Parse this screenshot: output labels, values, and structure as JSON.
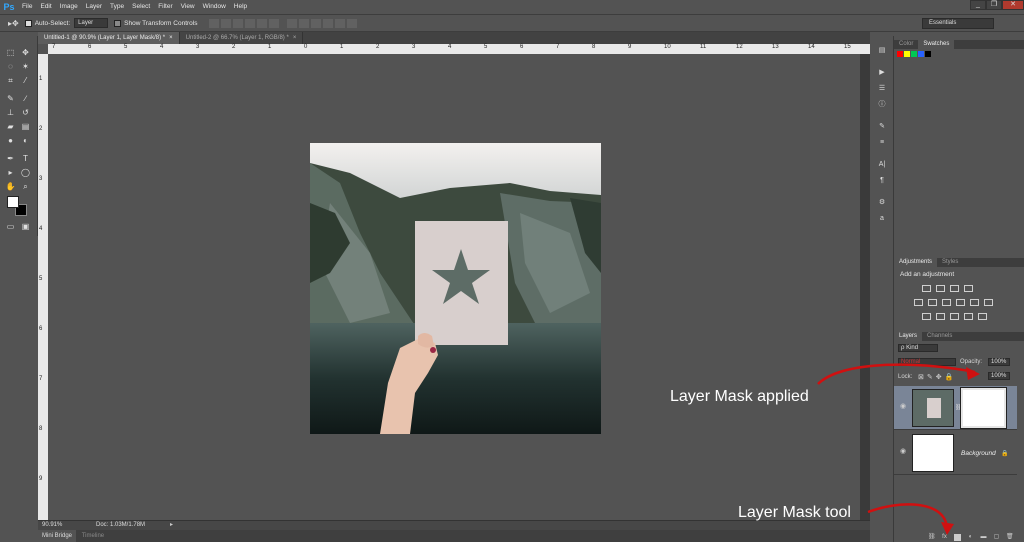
{
  "app": {
    "logo": "Ps"
  },
  "menu": [
    "File",
    "Edit",
    "Image",
    "Layer",
    "Type",
    "Select",
    "Filter",
    "View",
    "Window",
    "Help"
  ],
  "window_buttons": [
    "_",
    "❐",
    "✕"
  ],
  "options_bar": {
    "auto_select_label": "Auto-Select:",
    "auto_select_value": "Layer",
    "show_transform_label": "Show Transform Controls",
    "workspace": "Essentials"
  },
  "document_tabs": [
    {
      "title": "Untitled-1 @ 90.9% (Layer 1, Layer Mask/8) *",
      "active": true
    },
    {
      "title": "Untitled-2 @ 66.7% (Layer 1, RGB/8) *",
      "active": false
    }
  ],
  "ruler": {
    "h": [
      "7",
      "6",
      "5",
      "4",
      "3",
      "2",
      "1",
      "0",
      "1",
      "2",
      "3",
      "4",
      "5",
      "6",
      "7",
      "8",
      "9",
      "10",
      "11",
      "12",
      "13",
      "14",
      "15"
    ],
    "v": [
      "1",
      "2",
      "3",
      "4",
      "5",
      "6",
      "7",
      "8",
      "9"
    ]
  },
  "status": {
    "zoom": "90.91%",
    "doc": "Doc: 1.03M/1.78M"
  },
  "bottom_tabs": [
    "Mini Bridge",
    "Timeline"
  ],
  "panels": {
    "color_tabs": [
      "Color",
      "Swatches"
    ],
    "swatch_colors": [
      "#ff0000",
      "#ffff00",
      "#00c853",
      "#2962ff",
      "#000000"
    ],
    "adjust_tabs": [
      "Adjustments",
      "Styles"
    ],
    "adjust_heading": "Add an adjustment",
    "layers_tabs": [
      "Layers",
      "Channels"
    ],
    "kind": "ρ Kind",
    "blend_mode": "Normal",
    "opacity_label": "Opacity:",
    "opacity_value": "100%",
    "lock_label": "Lock:",
    "fill_value": "100%",
    "layers": [
      {
        "name": "",
        "has_mask": true,
        "selected": true
      },
      {
        "name": "Background",
        "has_mask": false,
        "selected": false
      }
    ]
  },
  "annotations": {
    "mask_applied": "Layer Mask applied",
    "mask_tool": "Layer Mask tool",
    "arrow_color": "#d01010"
  },
  "icons": {
    "eye": "eye-icon",
    "lock": "lock-icon",
    "mask": "add-layer-mask-icon"
  }
}
